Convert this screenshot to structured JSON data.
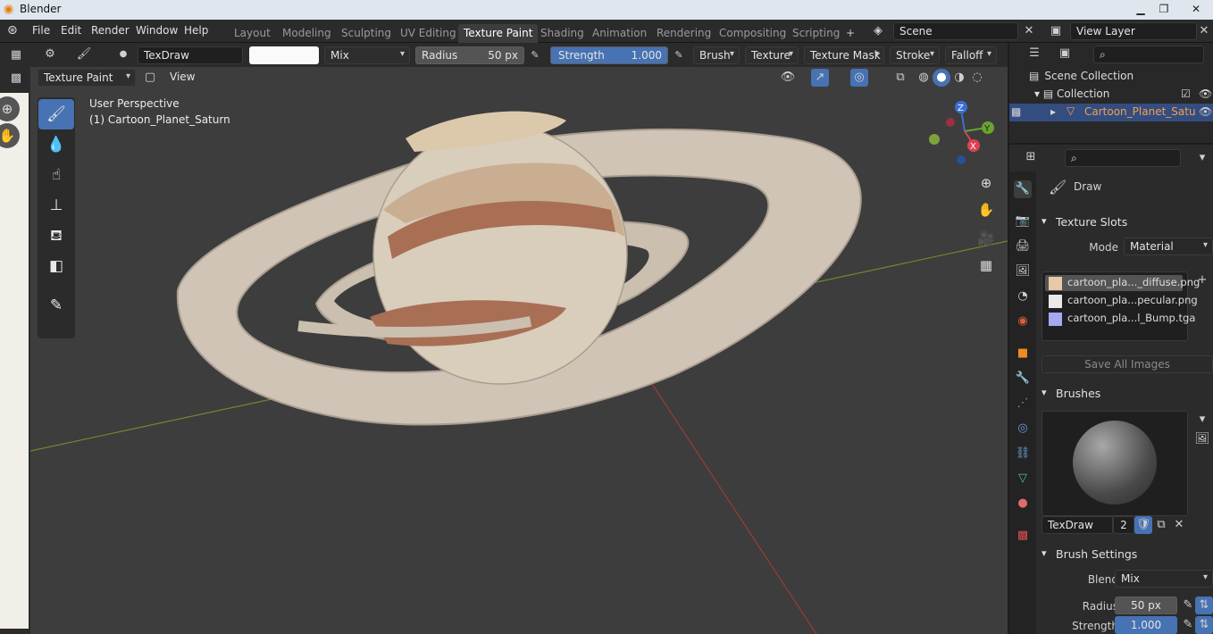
{
  "window": {
    "title": "Blender"
  },
  "menubar": {
    "items": [
      "File",
      "Edit",
      "Render",
      "Window",
      "Help"
    ]
  },
  "workspaces": [
    "Layout",
    "Modeling",
    "Sculpting",
    "UV Editing",
    "Texture Paint",
    "Shading",
    "Animation",
    "Rendering",
    "Compositing",
    "Scripting"
  ],
  "active_workspace": "Texture Paint",
  "add_workspace": "+",
  "scene": {
    "name": "Scene",
    "view_layer": "View Layer"
  },
  "tool_header": {
    "brush_name": "TexDraw",
    "blend": "Mix",
    "radius_label": "Radius",
    "radius_value": "50 px",
    "strength_label": "Strength",
    "strength_value": "1.000",
    "strength_fill": 1.0,
    "menus": [
      "Brush",
      "Texture",
      "Texture Mask",
      "Stroke",
      "Falloff"
    ]
  },
  "viewport_header": {
    "mode": "Texture Paint",
    "view": "View"
  },
  "viewport": {
    "perspective": "User Perspective",
    "object": "(1) Cartoon_Planet_Saturn"
  },
  "gizmo": {
    "z": "Z",
    "y": "Y",
    "x": "X"
  },
  "outliner": {
    "scene_collection": "Scene Collection",
    "collection": "Collection",
    "object": "Cartoon_Planet_Satu"
  },
  "properties": {
    "tool_name": "Draw",
    "texture_slots": {
      "title": "Texture Slots",
      "mode_label": "Mode",
      "mode_value": "Material",
      "slots": [
        {
          "name": "cartoon_pla..._diffuse.png",
          "color": "#e8c9a6"
        },
        {
          "name": "cartoon_pla...pecular.png",
          "color": "#e9e9e9"
        },
        {
          "name": "cartoon_pla...l_Bump.tga",
          "color": "#a9a6f2"
        }
      ],
      "save_all": "Save All Images"
    },
    "brushes": {
      "title": "Brushes",
      "brush_name": "TexDraw",
      "users": "2"
    },
    "brush_settings": {
      "title": "Brush Settings",
      "blend_label": "Blend",
      "blend_value": "Mix",
      "radius_label": "Radius",
      "radius_value": "50 px",
      "strength_label": "Strength",
      "strength_value": "1.000"
    }
  },
  "colors": {
    "accent": "#4772b3",
    "active_tab": "#3d3d3d",
    "planet": "#d9cdbc",
    "band_dark": "#a86f55",
    "ring": "#c8bcad"
  }
}
